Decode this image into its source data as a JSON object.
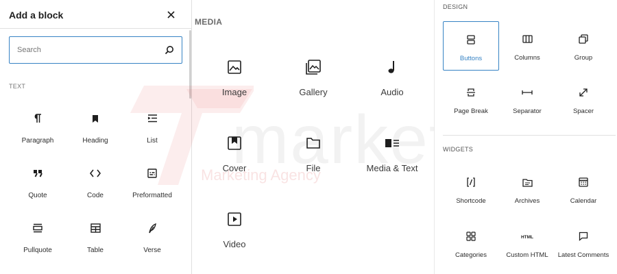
{
  "inserter": {
    "title": "Add a block",
    "close_icon": "close-icon",
    "search": {
      "placeholder": "Search",
      "value": "",
      "icon": "search-icon"
    },
    "text_section": {
      "title": "TEXT",
      "blocks": [
        {
          "label": "Paragraph",
          "icon": "paragraph-icon"
        },
        {
          "label": "Heading",
          "icon": "bookmark-icon"
        },
        {
          "label": "List",
          "icon": "list-icon"
        },
        {
          "label": "Quote",
          "icon": "quote-icon"
        },
        {
          "label": "Code",
          "icon": "code-icon"
        },
        {
          "label": "Preformatted",
          "icon": "preformatted-icon"
        },
        {
          "label": "Pullquote",
          "icon": "pullquote-icon"
        },
        {
          "label": "Table",
          "icon": "table-icon"
        },
        {
          "label": "Verse",
          "icon": "feather-icon"
        }
      ]
    }
  },
  "media_section": {
    "title": "MEDIA",
    "blocks": [
      {
        "label": "Image",
        "icon": "image-icon"
      },
      {
        "label": "Gallery",
        "icon": "gallery-icon"
      },
      {
        "label": "Audio",
        "icon": "music-note-icon"
      },
      {
        "label": "Cover",
        "icon": "cover-icon"
      },
      {
        "label": "File",
        "icon": "folder-icon"
      },
      {
        "label": "Media & Text",
        "icon": "media-text-icon"
      },
      {
        "label": "Video",
        "icon": "video-icon"
      }
    ]
  },
  "design_section": {
    "title": "DESIGN",
    "selected": "Buttons",
    "blocks": [
      {
        "label": "Buttons",
        "icon": "buttons-icon"
      },
      {
        "label": "Columns",
        "icon": "columns-icon"
      },
      {
        "label": "Group",
        "icon": "group-icon"
      },
      {
        "label": "Page Break",
        "icon": "page-break-icon"
      },
      {
        "label": "Separator",
        "icon": "separator-icon"
      },
      {
        "label": "Spacer",
        "icon": "spacer-icon"
      }
    ]
  },
  "widgets_section": {
    "title": "WIDGETS",
    "blocks": [
      {
        "label": "Shortcode",
        "icon": "shortcode-icon"
      },
      {
        "label": "Archives",
        "icon": "archives-icon"
      },
      {
        "label": "Calendar",
        "icon": "calendar-icon"
      },
      {
        "label": "Categories",
        "icon": "categories-icon"
      },
      {
        "label": "Custom HTML",
        "icon": "html-icon"
      },
      {
        "label": "Latest Comments",
        "icon": "comment-icon"
      }
    ]
  },
  "watermark": {
    "text": "marketing",
    "subtext": "Marketing Agency",
    "logo": "logo-icon",
    "color": "#f3c9c9"
  },
  "colors": {
    "accent": "#3582c4",
    "text": "#1e1e1e",
    "muted": "#757575",
    "border": "#e0e0e0"
  }
}
